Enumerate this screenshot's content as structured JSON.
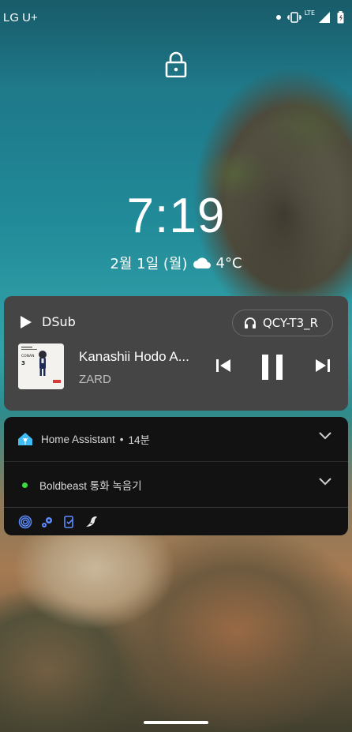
{
  "status_bar": {
    "carrier": "LG U+",
    "network_type": "LTE",
    "icons": [
      "notification-dot",
      "vibrate-icon",
      "signal-icon",
      "battery-icon"
    ]
  },
  "lockscreen": {
    "time": "7:19",
    "date": "2월 1일 (월)",
    "weather_icon": "cloud-icon",
    "temperature": "4°C"
  },
  "media": {
    "app_name": "DSub",
    "output_device": "QCY-T3_R",
    "track_title": "Kanashii Hodo A...",
    "artist": "ZARD",
    "album_art_text": "CONAN",
    "album_art_number": "3",
    "controls": [
      "previous",
      "pause",
      "next"
    ]
  },
  "notifications": [
    {
      "app": "Home Assistant",
      "separator": "•",
      "time": "14분",
      "icon": "home-assistant-icon"
    },
    {
      "app": "Boldbeast 통화 녹음기",
      "icon": "green-dot-icon"
    }
  ],
  "tray_icons": [
    "fingerprint-icon",
    "settings-icon",
    "sync-icon",
    "bird-icon"
  ],
  "colors": {
    "media_card_bg": "#454545",
    "notification_bg": "#121212",
    "accent_blue": "#5c8cff",
    "ha_blue": "#41bdf5",
    "green_dot": "#3ddc3d"
  }
}
